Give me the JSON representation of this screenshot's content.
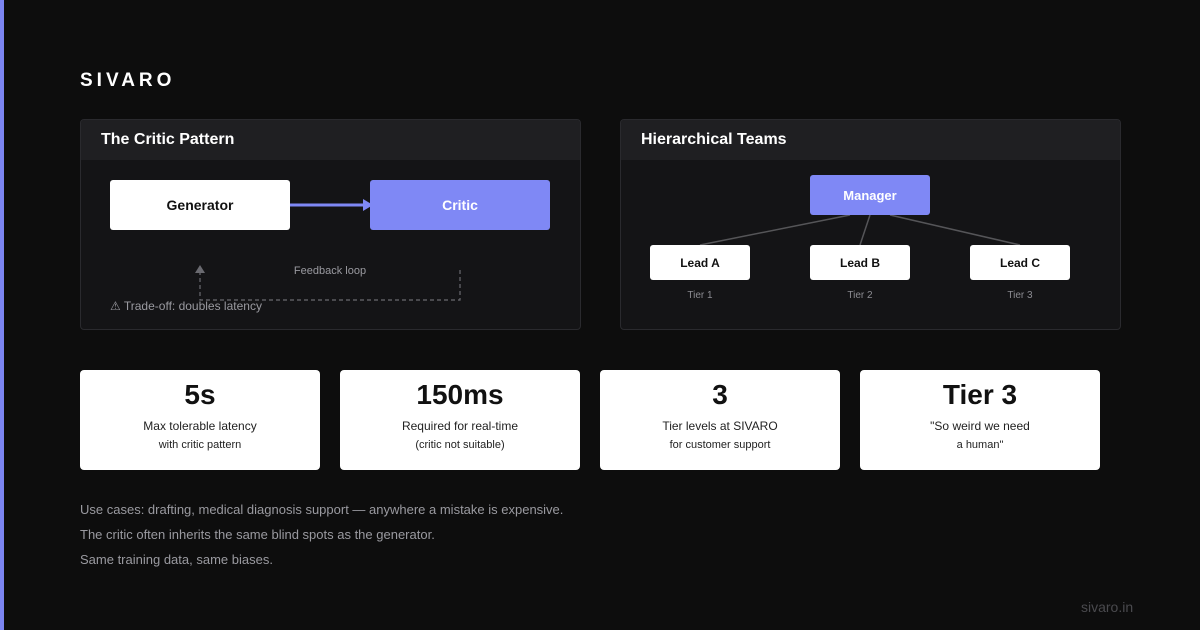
{
  "brand": "SIVARO",
  "critic_panel": {
    "title": "The Critic Pattern",
    "generator_label": "Generator",
    "critic_label": "Critic",
    "loop_label": "Feedback loop",
    "tradeoff": "⚠ Trade-off: doubles latency"
  },
  "hierarchy_panel": {
    "title": "Hierarchical Teams",
    "manager_label": "Manager",
    "leads": [
      {
        "label": "Lead A",
        "tier": "Tier 1"
      },
      {
        "label": "Lead B",
        "tier": "Tier 2"
      },
      {
        "label": "Lead C",
        "tier": "Tier 3"
      }
    ]
  },
  "stats": [
    {
      "value": "5s",
      "line1": "Max tolerable latency",
      "line2": "with critic pattern"
    },
    {
      "value": "150ms",
      "line1": "Required for real-time",
      "line2": "(critic not suitable)"
    },
    {
      "value": "3",
      "line1": "Tier levels at SIVARO",
      "line2": "for customer support"
    },
    {
      "value": "Tier 3",
      "line1": "\"So weird we need",
      "line2": "a human\""
    }
  ],
  "notes": [
    "Use cases: drafting, medical diagnosis support — anywhere a mistake is expensive.",
    "The critic often inherits the same blind spots as the generator.",
    "Same training data, same biases."
  ],
  "footer_url": "sivaro.in",
  "colors": {
    "background": "#0d0d0d",
    "accent": "#7f88f5",
    "panel": "#141416",
    "panel_header": "#1f1f22"
  }
}
